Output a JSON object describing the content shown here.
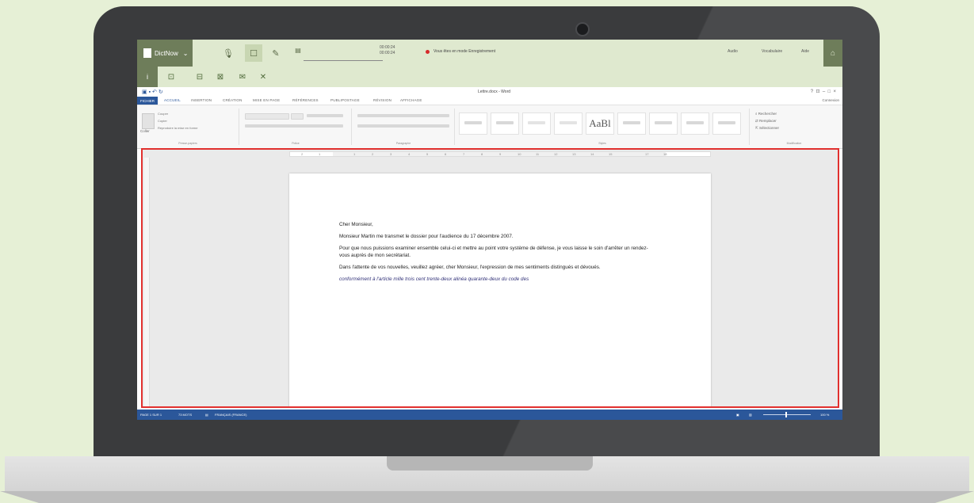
{
  "dictation_bar": {
    "app_name": "DictNow",
    "time_total": "00:00:24",
    "time_current": "00:00:24",
    "recording_text": "Vous êtes en mode Enregistrement",
    "menu": [
      "Aide",
      "Vocabulaire",
      "Audio"
    ],
    "accent": "#6e7d5a",
    "bar_bg": "#dfe9cf",
    "record_color": "#d62a2a"
  },
  "word": {
    "document_title": "Lettre.docx - Word",
    "tabs": [
      "FICHIER",
      "ACCUEIL",
      "INSERTION",
      "CRÉATION",
      "MISE EN PAGE",
      "RÉFÉRENCES",
      "PUBLIPOSTAGE",
      "RÉVISION",
      "AFFICHAGE"
    ],
    "sign_in": "Connexion",
    "clipboard": {
      "paste": "Coller",
      "cut": "Couper",
      "copy": "Copier",
      "format_painter": "Reproduire la mise en forme",
      "label": "Presse-papiers"
    },
    "group_labels": {
      "font": "Police",
      "paragraph": "Paragraphe",
      "styles": "Styles",
      "editing": "Modification"
    },
    "style_big": "AaBl",
    "editing": [
      "Rechercher",
      "Remplacer",
      "Sélectionner"
    ],
    "ruler_numbers": [
      "2",
      "1",
      "1",
      "2",
      "3",
      "4",
      "5",
      "6",
      "7",
      "8",
      "9",
      "10",
      "11",
      "12",
      "13",
      "14",
      "15",
      "17",
      "18"
    ],
    "letter": {
      "salutation": "Cher Monsieur,",
      "p1": "Monsieur Martin me transmet le dossier pour l'audience du 17 décembre 2007.",
      "p2": "Pour que nous puissions examiner ensemble celui-ci et mettre au point votre système de défense, je vous laisse le soin d'arrêter un rendez-vous auprès de mon secrétariat.",
      "p3": "Dans l'attente de vos nouvelles, veuillez agréer, cher Monsieur, l'expression de mes sentiments distingués et dévoués.",
      "dictated": "conformément à l'article mille trois cent trente-deux alinéa quarante-deux du code des"
    },
    "status": {
      "page": "PAGE 1 SUR 1",
      "words": "73 MOTS",
      "language": "FRANÇAIS (FRANCE)",
      "zoom": "100 %"
    },
    "word_blue": "#2b579a",
    "highlight_border": "#e1302e"
  }
}
